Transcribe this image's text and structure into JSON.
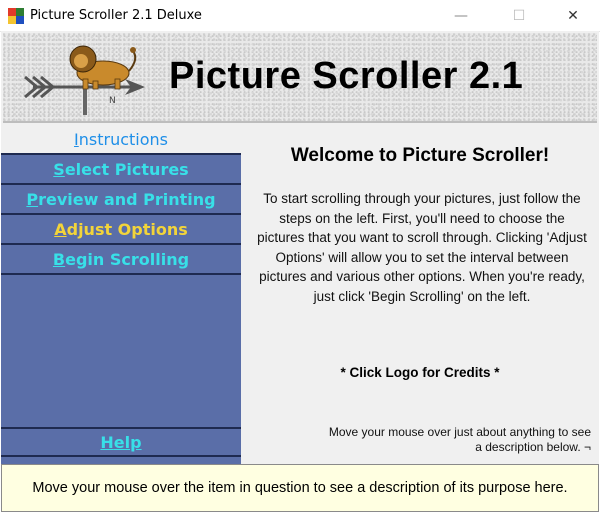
{
  "window": {
    "title": "Picture Scroller 2.1 Deluxe",
    "controls": {
      "minimize": "—",
      "maximize": "☐",
      "close": "✕"
    }
  },
  "banner": {
    "title": "Picture Scroller 2.1",
    "logo_icon": "lion-weathervane-logo"
  },
  "sidebar": {
    "items": [
      {
        "label": "Instructions",
        "mnemonic": "I",
        "rest": "nstructions",
        "active": true
      },
      {
        "label": "Select Pictures",
        "mnemonic": "S",
        "rest": "elect Pictures"
      },
      {
        "label": "Preview and Printing",
        "mnemonic": "P",
        "rest": "review and Printing"
      },
      {
        "label": "Adjust Options",
        "mnemonic": "A",
        "rest": "djust Options",
        "highlight": true
      },
      {
        "label": "Begin Scrolling",
        "mnemonic": "B",
        "rest": "egin Scrolling"
      }
    ],
    "help": {
      "label": "Help",
      "mnemonic": "H",
      "rest": "elp"
    }
  },
  "main": {
    "heading": "Welcome to Picture Scroller!",
    "intro": "To start scrolling through your pictures, just follow the steps on the left.  First, you'll need to choose the pictures that you want to scroll through.  Clicking 'Adjust Options' will allow you to set the interval between pictures and various other options.  When you're ready, just click 'Begin Scrolling' on the left.",
    "credits": "* Click Logo for Credits *",
    "hover_hint": "Move your mouse over just about anything to see a description below. ¬"
  },
  "description_bar": {
    "text": "Move your mouse over the item in question to see a description of its purpose here."
  },
  "colors": {
    "sidebar_bg": "#5a6ea8",
    "nav_text": "#38e0e8",
    "nav_highlight": "#f2d43a",
    "active_text": "#1f8fe8",
    "description_bg": "#ffffe1"
  }
}
